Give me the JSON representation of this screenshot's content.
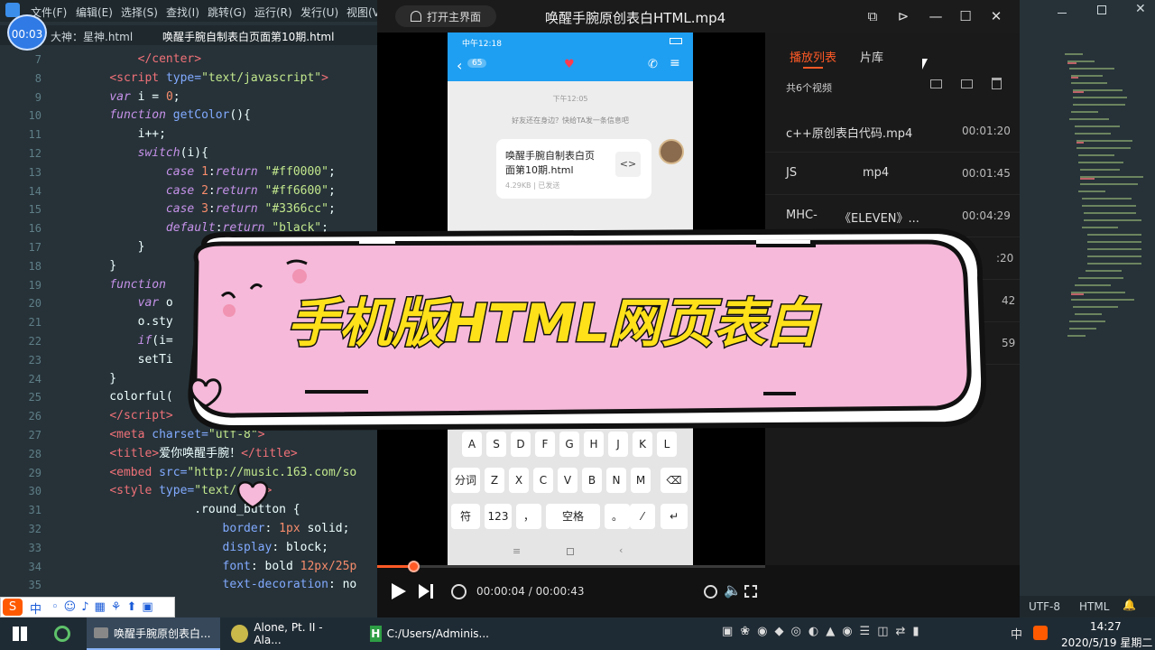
{
  "editor": {
    "menu": [
      "文件(F)",
      "编辑(E)",
      "选择(S)",
      "查找(I)",
      "跳转(G)",
      "运行(R)",
      "发行(U)",
      "视图(V"
    ],
    "tabs": [
      "大神：星神.html",
      "唤醒手腕自制表白页面第10期.html"
    ],
    "line_numbers": [
      "7",
      "8",
      "9",
      "10",
      "11",
      "12",
      "13",
      "14",
      "15",
      "16",
      "17",
      "18",
      "19",
      "20",
      "21",
      "22",
      "23",
      "24",
      "25",
      "26",
      "27",
      "28",
      "29",
      "30",
      "31",
      "32",
      "33",
      "34",
      "35"
    ],
    "status_encoding": "UTF-8",
    "status_lang": "HTML",
    "timer": "00:03"
  },
  "player": {
    "open_main_label": "打开主界面",
    "title": "唤醒手腕原创表白HTML.mp4",
    "tab_playlist": "播放列表",
    "tab_library": "片库",
    "video_count": "共6个视频",
    "items": [
      {
        "name": "c++原创表白代码.mp4",
        "duration": "00:01:20"
      },
      {
        "name": "JS",
        "name2": "mp4",
        "duration": "00:01:45"
      },
      {
        "name": "MHC-",
        "name2": "《ELEVEN》...",
        "duration": "00:04:29"
      },
      {
        "name": "",
        "duration": ":20"
      },
      {
        "name": "",
        "duration": "42"
      },
      {
        "name": "",
        "duration": "59"
      }
    ],
    "time_current": "00:00:04",
    "time_separator": "/",
    "time_total": "00:00:43",
    "progress": 0.093
  },
  "phone": {
    "status_time": "中午12:18",
    "back_count": "65",
    "chat_time": "下午12:05",
    "notice": "好友还在身边？快给TA发一条信息吧",
    "file_name_line1": "唤醒手腕自制表白页",
    "file_name_line2": "面第10期.html",
    "file_meta": "4.29KB | 已发送",
    "keys_row1": [
      "A",
      "S",
      "D",
      "F",
      "G",
      "H",
      "J",
      "K",
      "L"
    ],
    "keys_row2": [
      "分词",
      "Z",
      "X",
      "C",
      "V",
      "B",
      "N",
      "M"
    ],
    "keys_row3": [
      "符",
      "123",
      "，",
      "空格",
      "。"
    ]
  },
  "banner": {
    "text": "手机版HTML网页表白"
  },
  "taskbar": {
    "apps": [
      "唤醒手腕原创表白...",
      "Alone, Pt. II - Ala...",
      "C:/Users/Adminis..."
    ],
    "time": "14:27",
    "date": "2020/5/19 星期二",
    "ime": "中"
  },
  "colors": {
    "accent_orange": "#ff5a26",
    "banner_fill": "#f6b9d9",
    "banner_text": "#ffe11a"
  }
}
